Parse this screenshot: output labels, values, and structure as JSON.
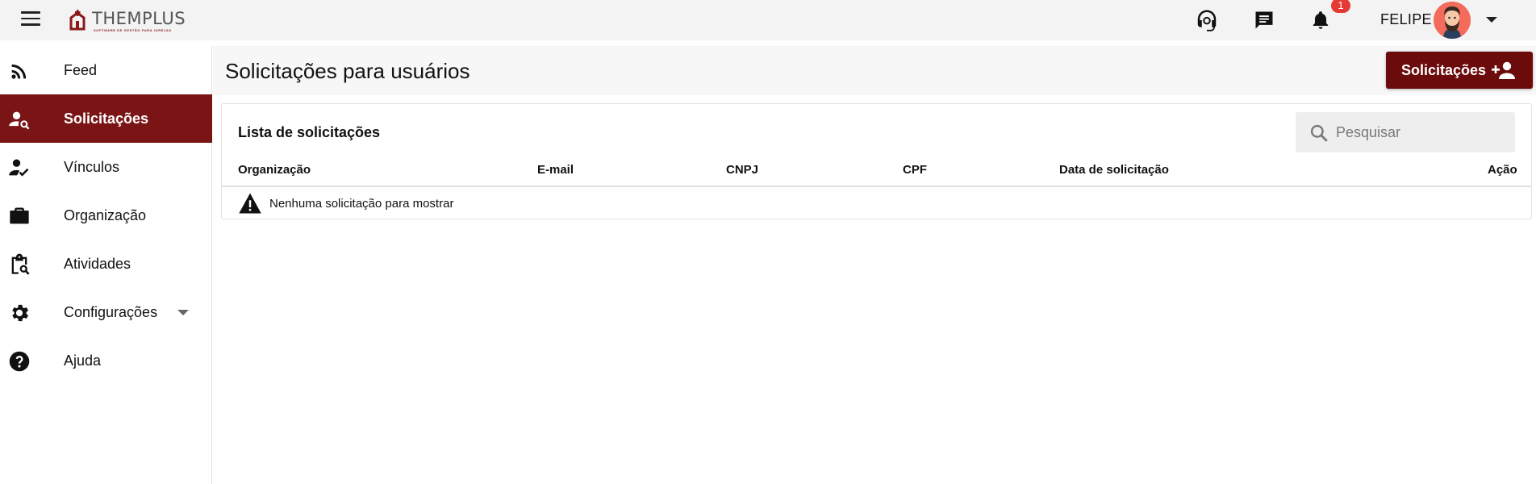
{
  "topbar": {
    "logo_text": "THEMPLUS",
    "logo_tagline": "SOFTWARE DE GESTÃO PARA IGREJAS",
    "notification_count": "1",
    "user_name": "FELIPE"
  },
  "sidebar": {
    "items": [
      {
        "label": "Feed",
        "icon": "rss-feed-icon"
      },
      {
        "label": "Solicitações",
        "icon": "person-search-icon",
        "active": true
      },
      {
        "label": "Vínculos",
        "icon": "person-check-icon"
      },
      {
        "label": "Organização",
        "icon": "briefcase-icon"
      },
      {
        "label": "Atividades",
        "icon": "clipboard-search-icon"
      },
      {
        "label": "Configurações",
        "icon": "gear-icon",
        "expandable": true
      },
      {
        "label": "Ajuda",
        "icon": "help-circle-icon"
      }
    ]
  },
  "main": {
    "page_title": "Solicitações para usuários",
    "primary_button": "Solicitações",
    "card": {
      "title": "Lista de solicitações",
      "search_placeholder": "Pesquisar",
      "columns": [
        "Organização",
        "E-mail",
        "CNPJ",
        "CPF",
        "Data de solicitação",
        "Ação"
      ],
      "empty_message": "Nenhuma solicitação para mostrar"
    }
  },
  "colors": {
    "brand": "#7b1515",
    "button": "#6b0b0b",
    "badge": "#e53935"
  }
}
